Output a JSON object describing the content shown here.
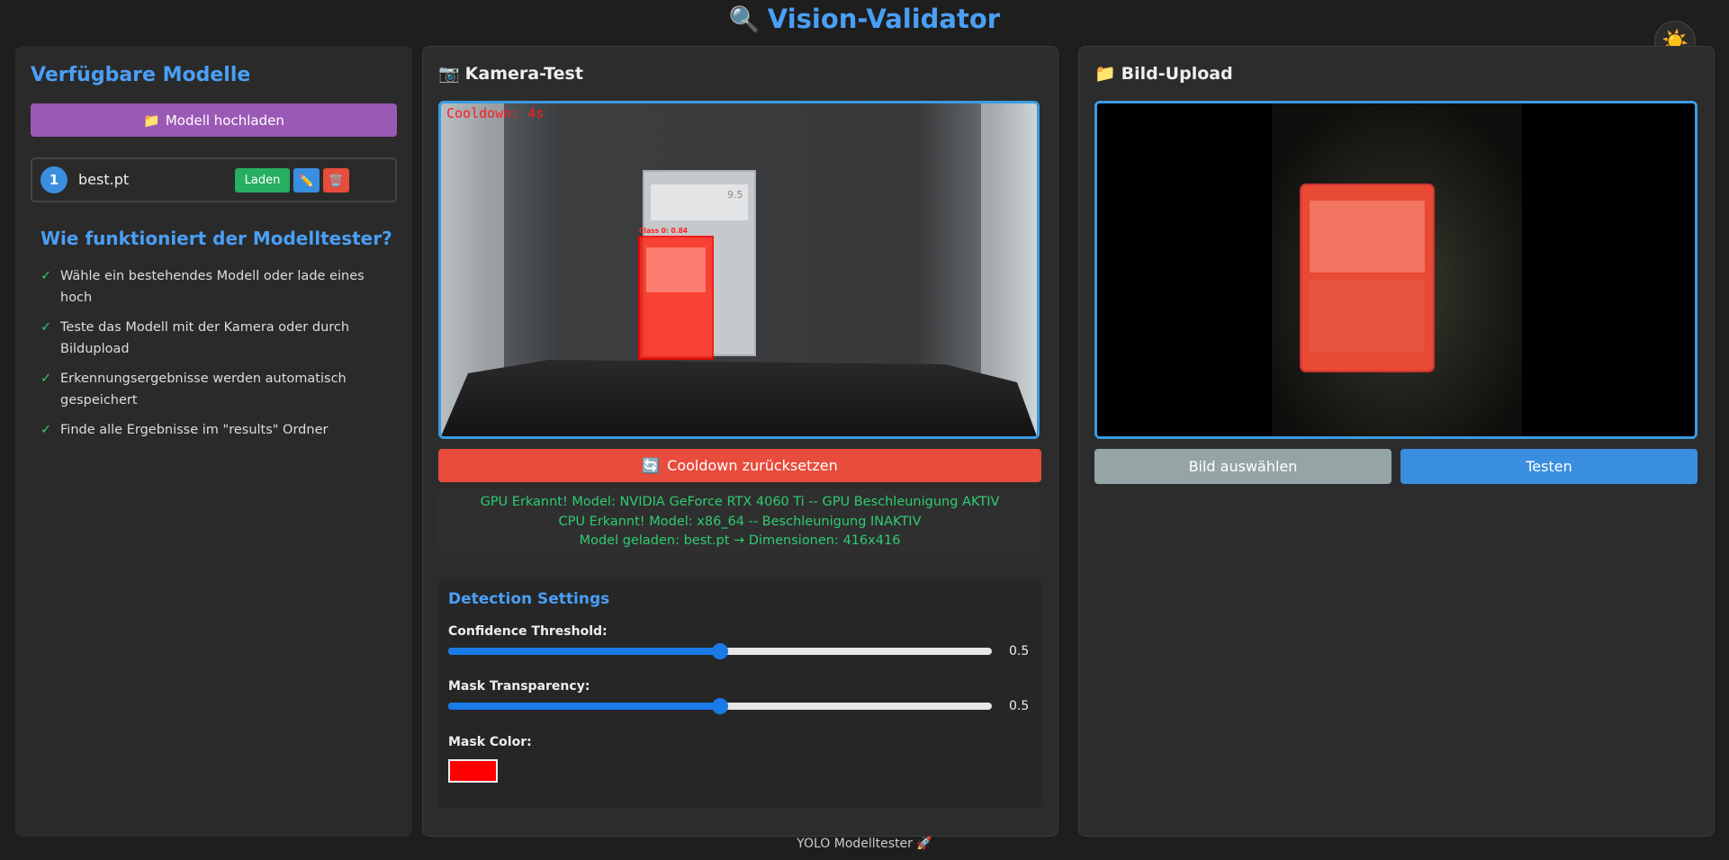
{
  "header": {
    "title_icon": "🔍",
    "title": "Vision-Validator",
    "theme_icon": "☀️"
  },
  "sidebar": {
    "title": "Verfügbare Modelle",
    "upload_icon": "📁",
    "upload_label": "Modell hochladen",
    "models": [
      {
        "number": "1",
        "name": "best.pt",
        "load_label": "Laden",
        "edit_icon": "✏️",
        "delete_icon": "🗑️"
      }
    ],
    "how_title": "Wie funktioniert der Modelltester?",
    "check_mark": "✓",
    "how_items": [
      "Wähle ein bestehendes Modell oder lade eines hoch",
      "Teste das Modell mit der Kamera oder durch Bildupload",
      "Erkennungsergebnisse werden automatisch gespeichert",
      "Finde alle Ergebnisse im \"results\" Ordner"
    ]
  },
  "camera": {
    "title_icon": "📷",
    "title": "Kamera-Test",
    "cooldown_overlay": "Cooldown: 4s",
    "detection_label": "Class 0: 0.84",
    "reset_icon": "🔄",
    "reset_label": "Cooldown zurücksetzen",
    "status_lines": [
      "GPU Erkannt! Model: NVIDIA GeForce RTX 4060 Ti -- GPU Beschleunigung AKTIV",
      "CPU Erkannt! Model: x86_64 -- Beschleunigung INAKTIV",
      "Model geladen: best.pt → Dimensionen: 416x416"
    ]
  },
  "settings": {
    "title": "Detection Settings",
    "confidence_label": "Confidence Threshold:",
    "confidence_value": "0.5",
    "confidence_fraction": 0.5,
    "transparency_label": "Mask Transparency:",
    "transparency_value": "0.5",
    "transparency_fraction": 0.5,
    "mask_color_label": "Mask Color:",
    "mask_color": "#ff0000"
  },
  "upload": {
    "title_icon": "📁",
    "title": "Bild-Upload",
    "select_label": "Bild auswählen",
    "test_label": "Testen"
  },
  "footer": {
    "text": "YOLO Modelltester 🚀"
  }
}
